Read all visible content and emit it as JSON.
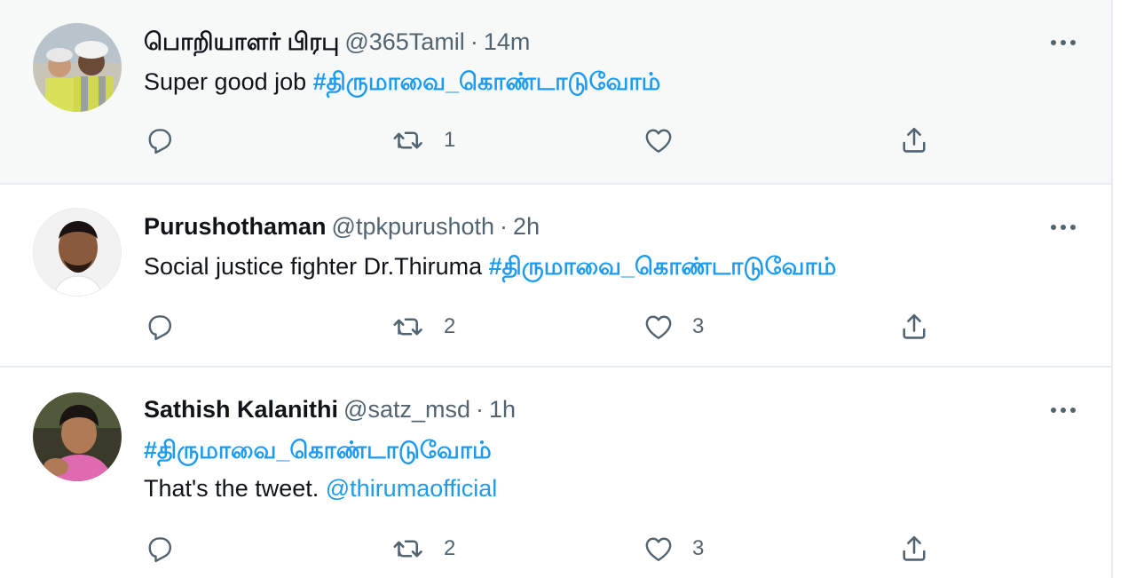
{
  "tweets": [
    {
      "name": "பொறியாளர் பிரபு",
      "handle": "@365Tamil",
      "separator": "·",
      "time": "14m",
      "text": "Super good job ",
      "hashtag": "#திருமாவை_கொண்டாடுவோம்",
      "retweets": "1",
      "likes": "",
      "avatar_icon": "avatar-photo-workers"
    },
    {
      "name": "Purushothaman",
      "handle": "@tpkpurushoth",
      "separator": "·",
      "time": "2h",
      "text": "Social justice fighter Dr.Thiruma ",
      "hashtag": "#திருமாவை_கொண்டாடுவோம்",
      "retweets": "2",
      "likes": "3",
      "avatar_icon": "avatar-photo-man"
    },
    {
      "name": "Sathish Kalanithi",
      "handle": "@satz_msd",
      "separator": "·",
      "time": "1h",
      "hashtag": "#திருமாவை_கொண்டாடுவோம்",
      "text2": "That's the tweet. ",
      "mention": "@thirumaofficial",
      "retweets": "2",
      "likes": "3",
      "avatar_icon": "avatar-photo-man-pink"
    }
  ],
  "icons": {
    "more": "more-icon",
    "reply": "reply-icon",
    "retweet": "retweet-icon",
    "like": "like-icon",
    "share": "share-icon"
  },
  "colors": {
    "link": "#1d9bf0",
    "secondary_text": "#536471",
    "primary_text": "#0f1419",
    "highlight_bg": "#f7f9f9",
    "divider": "#e6ecf0"
  }
}
